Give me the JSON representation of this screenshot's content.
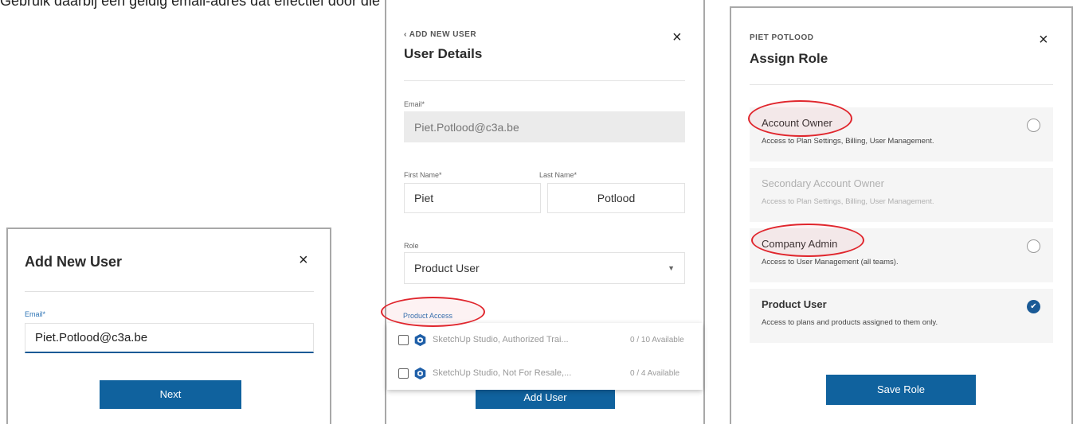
{
  "caption": "Gebruik daarbij een geldig email-adres dat effectief door die \"user\" te gebruiken is !",
  "panel1": {
    "title": "Add New User",
    "close": "×",
    "email_label": "Email*",
    "email_value": "Piet.Potlood@c3a.be",
    "next_label": "Next"
  },
  "panel2": {
    "back_label": "‹ ADD NEW USER",
    "title": "User Details",
    "close": "×",
    "email_label": "Email*",
    "email_value": "Piet.Potlood@c3a.be",
    "first_name_label": "First Name*",
    "first_name_value": "Piet",
    "last_name_label": "Last Name*",
    "last_name_value": "Potlood",
    "role_label": "Role",
    "role_value": "Product User",
    "product_access_label": "Product Access",
    "products": [
      {
        "name": "SketchUp Studio, Authorized Trai...",
        "count": "0 / 10  Available"
      },
      {
        "name": "SketchUp Studio, Not For Resale,...",
        "count": "0 / 4  Available"
      }
    ],
    "add_user_label": "Add User"
  },
  "panel3": {
    "eyebrow": "PIET POTLOOD",
    "title": "Assign Role",
    "close": "×",
    "roles": [
      {
        "name": "Account Owner",
        "desc": "Access to Plan Settings, Billing, User Management."
      },
      {
        "name": "Secondary Account Owner",
        "desc": "Access to Plan Settings, Billing, User Management."
      },
      {
        "name": "Company Admin",
        "desc": "Access to User Management (all teams)."
      },
      {
        "name": "Product User",
        "desc": "Access to plans and products assigned to them only."
      }
    ],
    "checkmark": "✔",
    "save_label": "Save Role"
  },
  "colors": {
    "primary": "#10629e",
    "annotation": "#e0262d",
    "card_bg": "#f5f5f5"
  }
}
